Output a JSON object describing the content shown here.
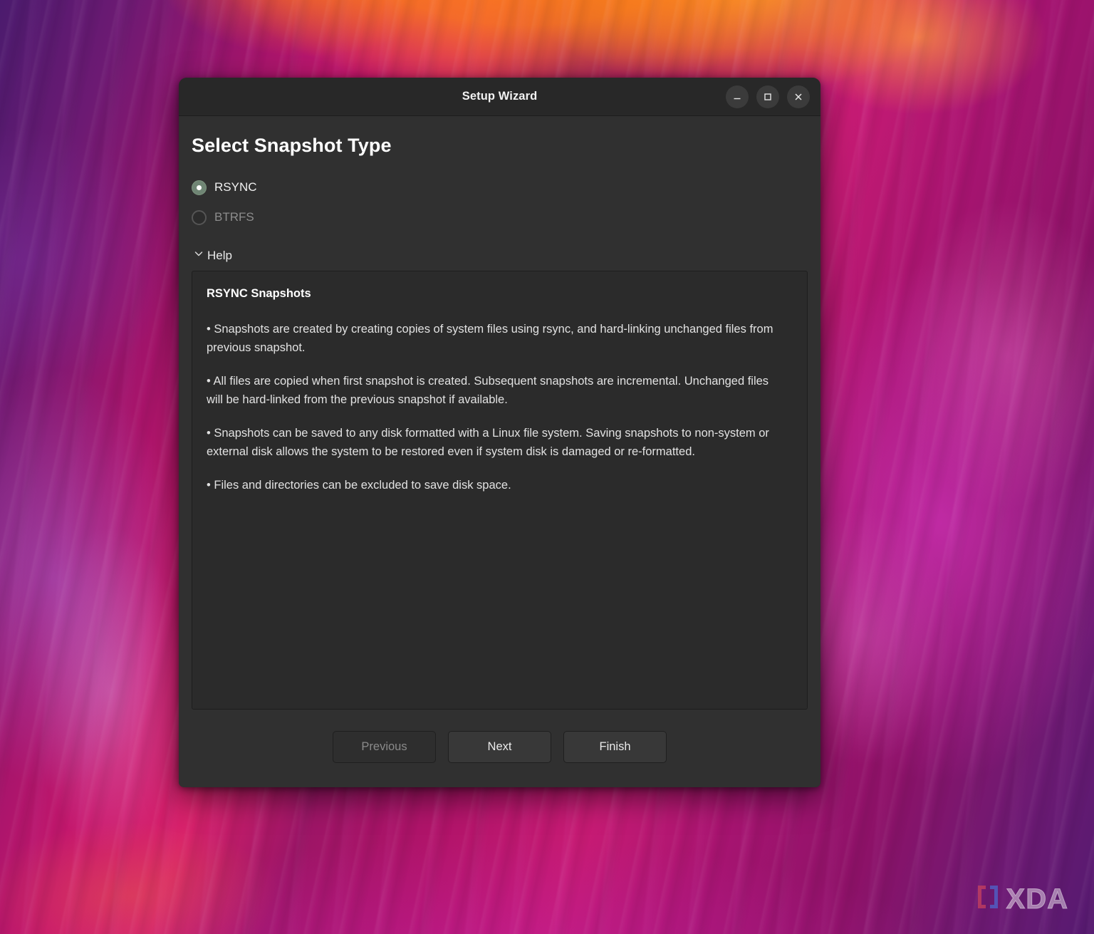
{
  "window": {
    "title": "Setup Wizard",
    "controls": [
      {
        "name": "minimize",
        "label": "—",
        "icon": "minimize-icon"
      },
      {
        "name": "maximize",
        "label": "□",
        "icon": "maximize-icon"
      },
      {
        "name": "close",
        "label": "×",
        "icon": "close-icon"
      }
    ]
  },
  "page": {
    "title": "Select Snapshot Type"
  },
  "snapshot_type": {
    "selected": "RSYNC",
    "options": [
      {
        "label": "RSYNC",
        "selected": true,
        "disabled": false
      },
      {
        "label": "BTRFS",
        "selected": false,
        "disabled": true
      }
    ]
  },
  "help": {
    "toggle_label": "Help",
    "expanded": true,
    "chevron_icon": "chevron-down-icon",
    "heading": "RSYNC Snapshots",
    "paragraphs": [
      "• Snapshots are created by creating copies of system files using rsync, and hard-linking unchanged files from previous snapshot.",
      "• All files are copied when first snapshot is created. Subsequent snapshots are incremental. Unchanged files will be hard-linked from the previous snapshot if available.",
      "• Snapshots can be saved to any disk formatted with a Linux file system. Saving snapshots to non-system or external disk allows the system to be restored even if system disk is damaged or re-formatted.",
      "• Files and directories can be excluded to save disk space."
    ]
  },
  "footer": {
    "buttons": [
      {
        "label": "Previous",
        "disabled": true
      },
      {
        "label": "Next",
        "disabled": false
      },
      {
        "label": "Finish",
        "disabled": false
      }
    ]
  },
  "watermark": {
    "text": "XDA",
    "bracket_icon": "xda-bracket-logo-icon"
  },
  "colors": {
    "window_bg": "#303030",
    "titlebar_bg": "#282828",
    "help_panel_bg": "#2b2b2b",
    "radio_selected": "#6f8574",
    "text_primary": "#f0f0f0",
    "text_disabled": "#8a8a8a"
  }
}
